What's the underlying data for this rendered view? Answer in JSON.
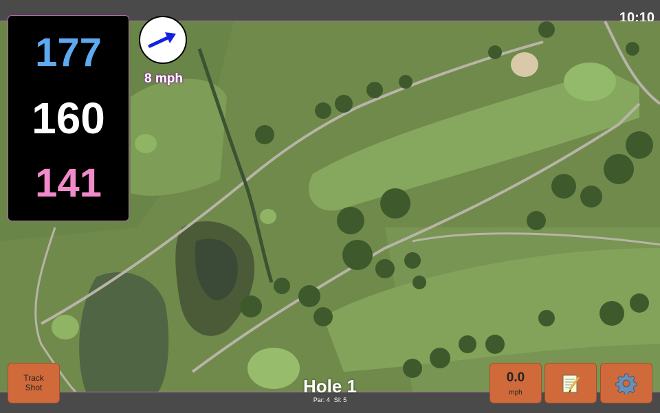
{
  "status": {
    "time": "10:10"
  },
  "yardage": {
    "back": "177",
    "middle": "160",
    "front": "141"
  },
  "wind": {
    "speed": "8 mph",
    "direction_icon": "arrow-icon"
  },
  "buttons": {
    "track_shot": "Track Shot",
    "speed_value": "0.0",
    "speed_unit": "mph",
    "notes_icon": "notepad-icon",
    "settings_icon": "gear-icon"
  },
  "hole": {
    "title": "Hole 1",
    "par": "Par: 4",
    "si": "SI: 5"
  },
  "colors": {
    "back_yardage": "#5ea9ef",
    "front_yardage": "#f18ac9",
    "button": "#d06a3b",
    "accent_border": "#b56fb0"
  }
}
